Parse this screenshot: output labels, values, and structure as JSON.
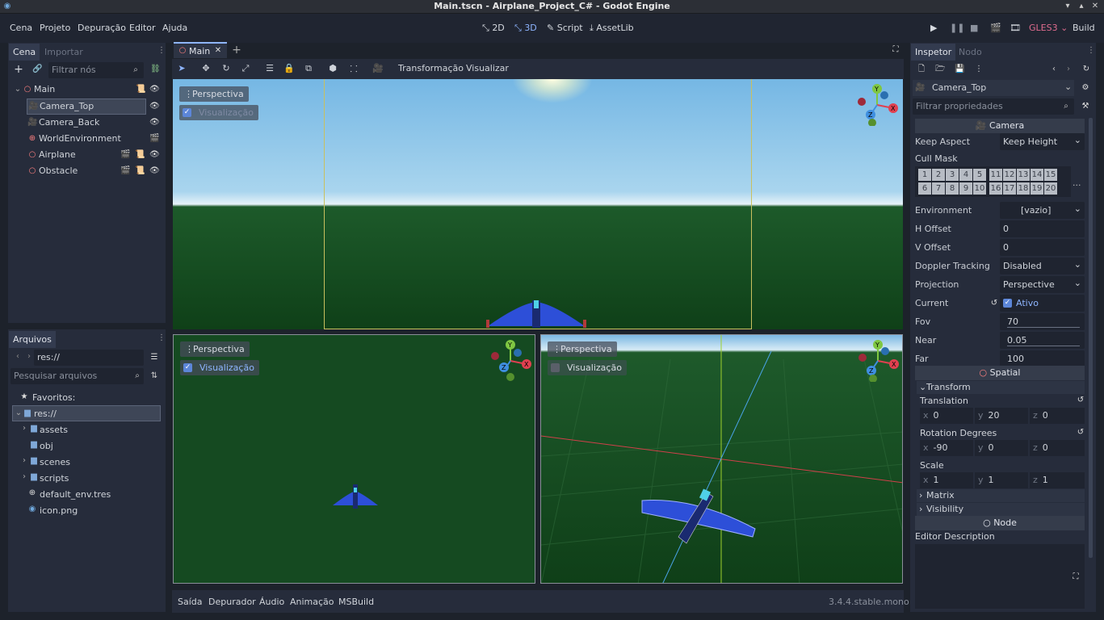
{
  "window": {
    "title": "Main.tscn - Airplane_Project_C# - Godot Engine"
  },
  "menu": [
    "Cena",
    "Projeto",
    "Depuração",
    "Editor",
    "Ajuda"
  ],
  "modes": {
    "d2": "2D",
    "d3": "3D",
    "script": "Script",
    "assetlib": "AssetLib"
  },
  "renderer": "GLES3",
  "build": "Build",
  "scene_dock": {
    "tabs": [
      "Cena",
      "Importar"
    ],
    "filter_placeholder": "Filtrar nós",
    "nodes": [
      {
        "label": "Main"
      },
      {
        "label": "Camera_Top"
      },
      {
        "label": "Camera_Back"
      },
      {
        "label": "WorldEnvironment"
      },
      {
        "label": "Airplane"
      },
      {
        "label": "Obstacle"
      }
    ]
  },
  "files_dock": {
    "tab": "Arquivos",
    "path": "res://",
    "search_placeholder": "Pesquisar arquivos",
    "items": [
      {
        "label": "Favoritos:"
      },
      {
        "label": "res://"
      },
      {
        "label": "assets"
      },
      {
        "label": "obj"
      },
      {
        "label": "scenes"
      },
      {
        "label": "scripts"
      },
      {
        "label": "default_env.tres"
      },
      {
        "label": "icon.png"
      }
    ]
  },
  "editor_tab": "Main",
  "toolbar": {
    "transform": "Transformação",
    "view": "Visualizar"
  },
  "viewports": {
    "perspective": "Perspectiva",
    "preview": "Visualização"
  },
  "bottom": {
    "tabs": [
      "Saída",
      "Depurador",
      "Áudio",
      "Animação",
      "MSBuild"
    ],
    "version": "3.4.4.stable.mono"
  },
  "inspector": {
    "tabs": [
      "Inspetor",
      "Nodo"
    ],
    "node": "Camera_Top",
    "filter_placeholder": "Filtrar propriedades",
    "camera_section": "Camera",
    "keep_aspect": {
      "label": "Keep Aspect",
      "value": "Keep Height"
    },
    "cull_mask": {
      "label": "Cull Mask",
      "row1": [
        "1",
        "2",
        "3",
        "4",
        "5",
        "11",
        "12",
        "13",
        "14",
        "15"
      ],
      "row2": [
        "6",
        "7",
        "8",
        "9",
        "10",
        "16",
        "17",
        "18",
        "19",
        "20"
      ],
      "more": "..."
    },
    "environment": {
      "label": "Environment",
      "value": "[vazio]"
    },
    "h_offset": {
      "label": "H Offset",
      "value": "0"
    },
    "v_offset": {
      "label": "V Offset",
      "value": "0"
    },
    "doppler": {
      "label": "Doppler Tracking",
      "value": "Disabled"
    },
    "projection": {
      "label": "Projection",
      "value": "Perspective"
    },
    "current": {
      "label": "Current",
      "value": "Ativo"
    },
    "fov": {
      "label": "Fov",
      "value": "70"
    },
    "near": {
      "label": "Near",
      "value": "0.05"
    },
    "far": {
      "label": "Far",
      "value": "100"
    },
    "spatial_section": "Spatial",
    "transform_section": "Transform",
    "translation": {
      "label": "Translation",
      "x": "0",
      "y": "20",
      "z": "0"
    },
    "rotation": {
      "label": "Rotation Degrees",
      "x": "-90",
      "y": "0",
      "z": "0"
    },
    "scale": {
      "label": "Scale",
      "x": "1",
      "y": "1",
      "z": "1"
    },
    "matrix": "Matrix",
    "visibility": "Visibility",
    "node_section": "Node",
    "editor_description": "Editor Description"
  },
  "gizmo": {
    "x": "X",
    "y": "Y",
    "z": "Z"
  },
  "colors": {
    "accent": "#8eb5ff",
    "bg": "#262c3b",
    "sky_top": "#6fb6e4",
    "ground": "#14491e",
    "gles": "#e06c8f"
  }
}
